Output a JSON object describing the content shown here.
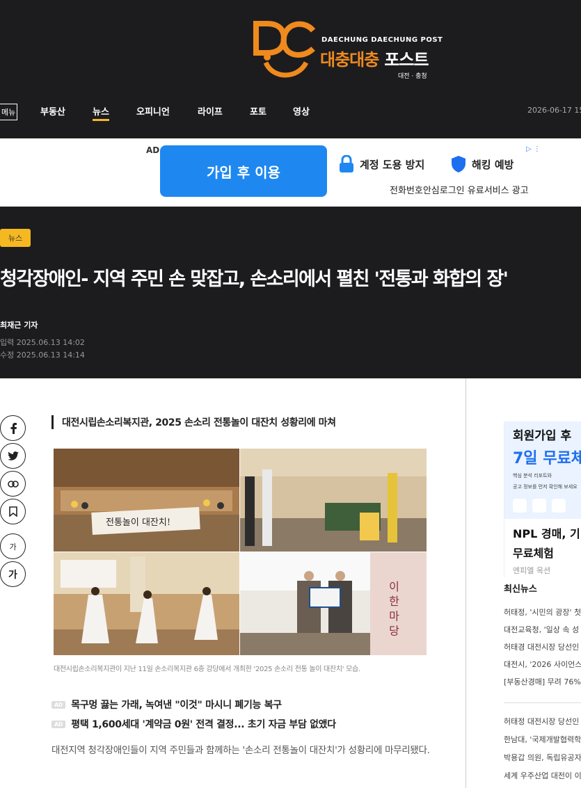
{
  "site": {
    "name_en": "DAECHUNG DAECHUNG POST",
    "name_ko_1": "대충대충",
    "name_ko_2": "포스트",
    "region": "대전 · 충청",
    "date": "2026-06-17 15:"
  },
  "nav": {
    "menu_label": "메뉴",
    "items": [
      "부동산",
      "뉴스",
      "오피니언",
      "라이프",
      "포토",
      "영상"
    ],
    "active": "뉴스"
  },
  "ad_banner": {
    "label": "AD",
    "button": "가입 후 이용",
    "feature_1": "계정 도용 방지",
    "feature_2": "해킹 예방",
    "sub": "전화번호안심로그인 유료서비스 광고",
    "colors": {
      "button": "#1e88f0"
    }
  },
  "article": {
    "category": "뉴스",
    "headline": "청각장애인- 지역 주민 손 맞잡고, 손소리에서 펼친 '전통과 화합의 장'",
    "reporter": "최재근 기자",
    "published": "입력 2025.06.13 14:02",
    "modified": "수정 2025.06.13 14:14",
    "subtitle": "대전시립손소리복지관, 2025 손소리 전통놀이 대잔치 성황리에 마쳐",
    "photo_banner_text": "전통놀이 대잔치!",
    "photo_board_text": "이 한 마 당",
    "caption": "대전시립손소리복지관이 지난 11일 손소리복지관 6층 강당에서 개최한 '2025 손소리 전통 놀이 대잔치' 모습.",
    "lead": "대전지역 청각장애인들이 지역 주민들과 함께하는 '손소리 전통놀이 대잔치'가 성황리에 마무리됐다."
  },
  "share": {
    "font_small": "가",
    "font_large": "가"
  },
  "ad_links": [
    {
      "tag": "AD",
      "text": "목구멍 끓는 가래, 녹여낸 \"이것\" 마시니 폐기능 복구"
    },
    {
      "tag": "AD",
      "text": "평택 1,600세대 '계약금 0원' 전격 결정... 초기 자금 부담 없앴다"
    }
  ],
  "sidebar": {
    "ad": {
      "h1": "회원가입 후",
      "h2": "7일 무료체",
      "small_1": "핵심 분석 리포트와",
      "small_2": "공고 정보를 먼저 확인해 보세요",
      "title_1": "NPL 경매, 기",
      "title_2": "무료체험",
      "source": "엔피엘 옥션"
    },
    "latest_title": "최신뉴스",
    "latest_1": [
      "허태정, '시민의 광장' 첫",
      "대전교육청, '일상 속 성",
      "허태경 대전시장 당선인",
      "대전시, '2026 사이언스",
      "[부동산경매] 무려 76%"
    ],
    "latest_2": [
      "허태정 대전시장 당선인",
      "한남대, '국제개발협력학",
      "박용갑 의원, 독립유공자",
      "세계 우주산업 대전이 이"
    ]
  }
}
